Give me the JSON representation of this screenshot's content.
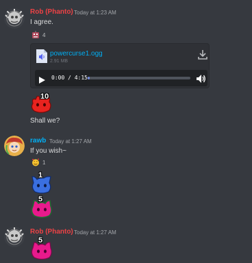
{
  "messages": [
    {
      "username": "Rob (Phanto)",
      "username_color": "#ed4245",
      "timestamp": "Today at 1:23 AM",
      "text": "I agree.",
      "reaction": {
        "icon": "robot-face-emoji",
        "count": "4"
      },
      "attachment": {
        "file_name": "powercurse1.ogg",
        "file_size": "2.91 MB",
        "time_display": "0:00 / 4:15",
        "progress": 0.02
      },
      "sticker": {
        "count": "10",
        "color": "#e8231f"
      },
      "followup_text": "Shall we?"
    },
    {
      "username": "rawb",
      "username_color": "#00aff4",
      "timestamp": "Today at 1:27 AM",
      "text": "If you wish~",
      "reaction": {
        "icon": "smiling-face-with-hearts-emoji",
        "count": "1"
      },
      "stickers": [
        {
          "count": "1",
          "color": "#3a6fe0"
        },
        {
          "count": "5",
          "color": "#e81a8c"
        }
      ]
    },
    {
      "username": "Rob (Phanto)",
      "username_color": "#ed4245",
      "timestamp": "Today at 1:27 AM",
      "sticker": {
        "count": "5",
        "color": "#e81a8c"
      }
    }
  ],
  "colors": {
    "background": "#36393f",
    "attachment_bg": "#2f3136",
    "link": "#00aff4",
    "muted": "#a3a6aa"
  }
}
